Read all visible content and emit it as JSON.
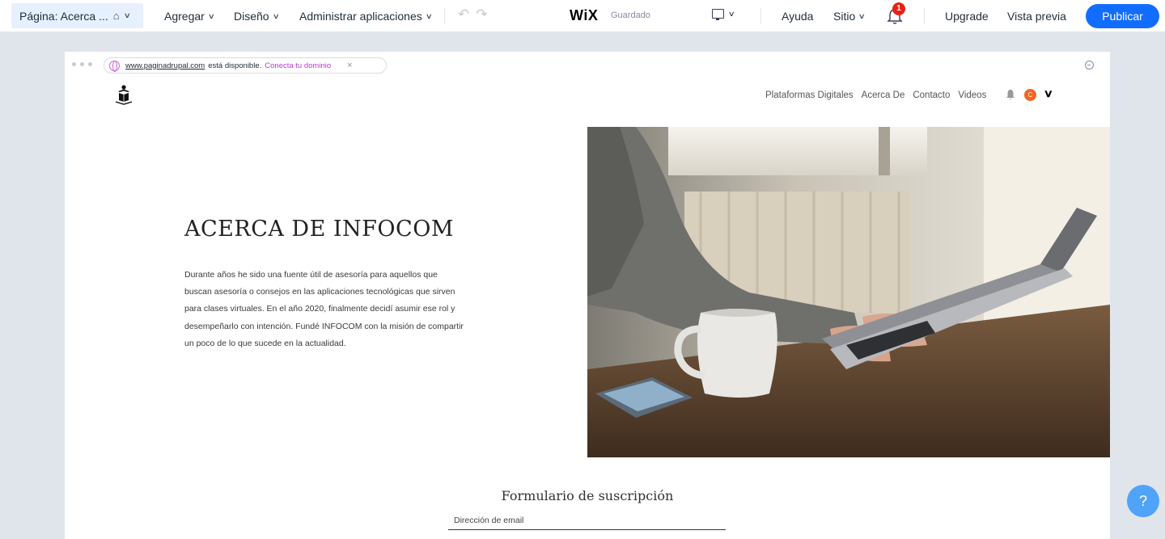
{
  "toolbar": {
    "page_label": "Página: Acerca ...",
    "menus": [
      {
        "label": "Agregar"
      },
      {
        "label": "Diseño"
      },
      {
        "label": "Administrar aplicaciones"
      }
    ],
    "logo": "WiX",
    "save_status": "Guardado",
    "help_label": "Ayuda",
    "site_label": "Sitio",
    "notification_count": "1",
    "upgrade_label": "Upgrade",
    "preview_label": "Vista previa",
    "publish_label": "Publicar"
  },
  "address_bar": {
    "url": "www.paginadrupal.com",
    "message": "está disponible.",
    "connect_label": "Conecta tu dominio",
    "close_glyph": "×"
  },
  "site": {
    "nav": [
      {
        "label": "Plataformas Digitales"
      },
      {
        "label": "Acerca De"
      },
      {
        "label": "Contacto"
      },
      {
        "label": "Videos"
      }
    ],
    "avatar_initial": "C",
    "hero": {
      "title": "ACERCA DE INFOCOM",
      "body": "Durante años he sido una fuente útil de asesoría para aquellos que buscan asesoría o consejos en las aplicaciones tecnológicas que sirven para clases virtuales. En el año 2020, finalmente decidí asumir ese rol y desempeñarlo con intención.  Fundé INFOCOM con la misión de compartir un poco de lo que sucede en la actualidad."
    },
    "subscription": {
      "title": "Formulario de suscripción",
      "email_placeholder": "Dirección de email"
    }
  },
  "help_glyph": "?",
  "colors": {
    "publish": "#116dff",
    "page_pill": "#e7f0ff",
    "notification_badge": "#e62214",
    "connect_link": "#b83ad0",
    "avatar": "#f26522",
    "help_button": "#4fa3f9"
  }
}
